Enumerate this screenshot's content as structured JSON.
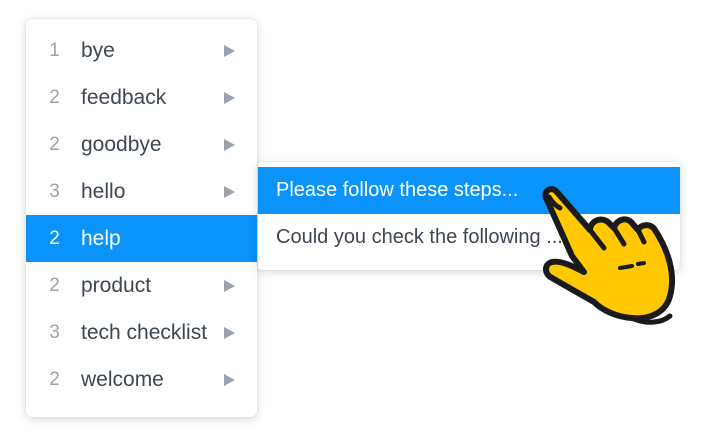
{
  "menu": {
    "items": [
      {
        "count": "1",
        "label": "bye"
      },
      {
        "count": "2",
        "label": "feedback"
      },
      {
        "count": "2",
        "label": "goodbye"
      },
      {
        "count": "3",
        "label": "hello"
      },
      {
        "count": "2",
        "label": "help",
        "active": true
      },
      {
        "count": "2",
        "label": "product"
      },
      {
        "count": "3",
        "label": "tech checklist"
      },
      {
        "count": "2",
        "label": "welcome"
      }
    ]
  },
  "submenu": {
    "items": [
      {
        "label": "Please follow these steps...",
        "active": true
      },
      {
        "label": "Could you check the following ..."
      }
    ]
  },
  "colors": {
    "accent": "#0a94fb",
    "text": "#3d4752",
    "count": "#9aa3ad",
    "hand_fill": "#ffc800",
    "hand_outline": "#1a1a1a"
  },
  "icons": {
    "arrow": "triangle-right-icon",
    "cursor": "pointing-hand-icon"
  }
}
